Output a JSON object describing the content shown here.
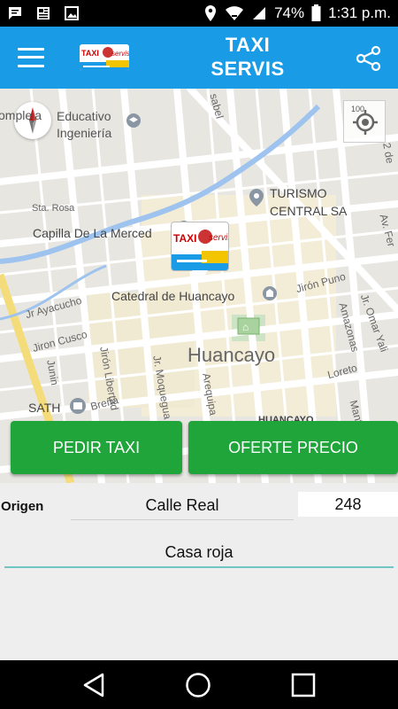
{
  "status_bar": {
    "battery": "74%",
    "time": "1:31 p.m.",
    "icons": [
      "message-icon",
      "news-icon",
      "image-icon",
      "location-icon",
      "wifi-icon",
      "signal-icon",
      "battery-icon"
    ]
  },
  "app_bar": {
    "title": "TAXI\nSERVIS",
    "logo_text": "TAXI servis",
    "menu_icon": "menu-icon",
    "share_icon": "share-icon"
  },
  "map": {
    "labels": {
      "complejo": "ompleja",
      "educativo": "Educativo",
      "ingenieria": "Ingeniería",
      "sta_rosa": "Sta. Rosa",
      "capilla": "Capilla De La Merced",
      "turismo": "TURISMO",
      "central": "CENTRAL SA",
      "catedral": "Catedral de Huancayo",
      "jiron_puno": "Jirón Puno",
      "jr_ayacucho": "Jr Ayacucho",
      "jiron_cusco": "Jiron Cusco",
      "city": "Huancayo",
      "junin": "Junin",
      "jiron_libertad": "Jirón Libertad",
      "jr_moquegua": "Jr. Moquegua",
      "arequipa": "Arequipa",
      "amazonas": "Amazonas",
      "jr_omar": "Jr. Omar Yali",
      "loreto": "Loreto",
      "sath": "SATH",
      "brena": "Breña",
      "huancayo_bottom": "HUANCAYO",
      "av_fer": "Av. Fer",
      "de_2": "2 de",
      "isabel": "sabel",
      "mantaro": "Mant"
    },
    "locate_label": "100"
  },
  "actions": {
    "request_taxi": "PEDIR TAXI",
    "offer_price": "OFERTE PRECIO"
  },
  "form": {
    "origin_label": "Origen",
    "street": "Calle Real",
    "number": "248",
    "reference": "Casa roja"
  },
  "colors": {
    "primary": "#1a9be6",
    "action_green": "#1fa53a",
    "accent_line": "#6fc6c4"
  }
}
